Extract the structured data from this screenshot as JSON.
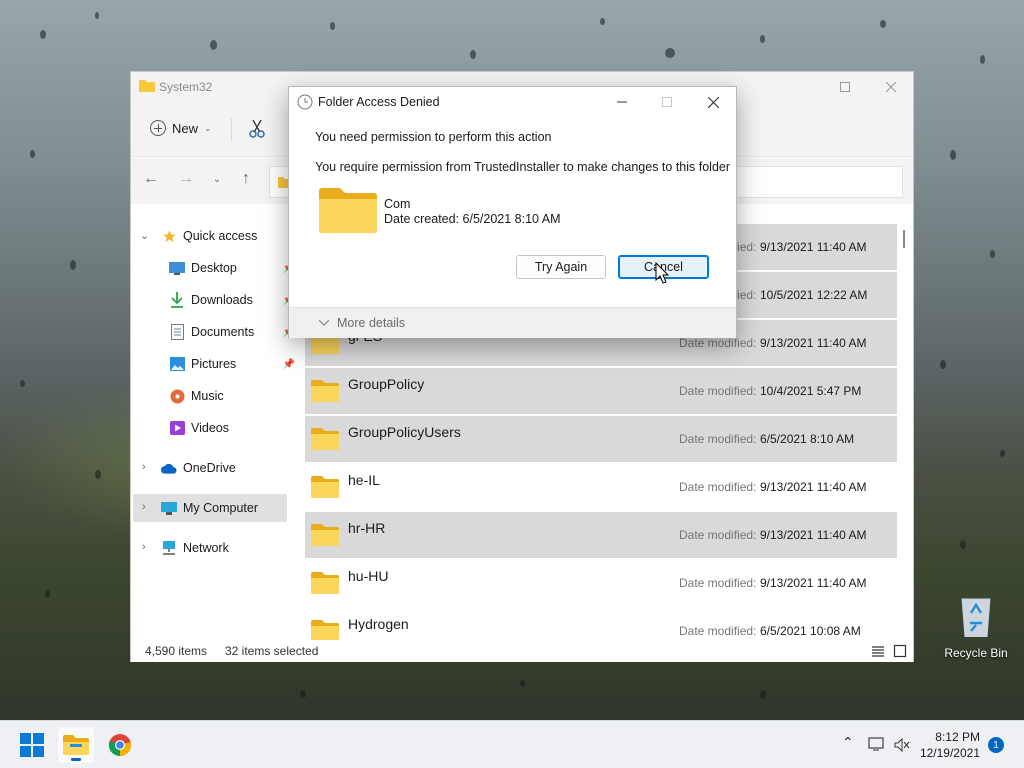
{
  "explorer": {
    "title": "System32",
    "toolbar": {
      "new_label": "New"
    },
    "sidebar": {
      "quick_access": "Quick access",
      "items": [
        {
          "label": "Desktop",
          "icon": "desktop-icon"
        },
        {
          "label": "Downloads",
          "icon": "downloads-icon"
        },
        {
          "label": "Documents",
          "icon": "documents-icon"
        },
        {
          "label": "Pictures",
          "icon": "pictures-icon"
        },
        {
          "label": "Music",
          "icon": "music-icon"
        },
        {
          "label": "Videos",
          "icon": "videos-icon"
        }
      ],
      "onedrive": "OneDrive",
      "my_computer": "My Computer",
      "network": "Network"
    },
    "files": {
      "date_label": "Date modified:",
      "rows": [
        {
          "name": "",
          "date": "9/13/2021 11:40 AM",
          "selected": false
        },
        {
          "name": "",
          "date": "9/13/2021 11:40 AM",
          "selected": true
        },
        {
          "name": "",
          "date": "10/5/2021 12:22 AM",
          "selected": true
        },
        {
          "name": "gl-ES",
          "date": "9/13/2021 11:40 AM",
          "selected": true
        },
        {
          "name": "GroupPolicy",
          "date": "10/4/2021 5:47 PM",
          "selected": true
        },
        {
          "name": "GroupPolicyUsers",
          "date": "6/5/2021 8:10 AM",
          "selected": true
        },
        {
          "name": "he-IL",
          "date": "9/13/2021 11:40 AM",
          "selected": false
        },
        {
          "name": "hr-HR",
          "date": "9/13/2021 11:40 AM",
          "selected": true
        },
        {
          "name": "hu-HU",
          "date": "9/13/2021 11:40 AM",
          "selected": false
        },
        {
          "name": "Hydrogen",
          "date": "6/5/2021 10:08 AM",
          "selected": false
        }
      ]
    },
    "status": {
      "item_count": "4,590 items",
      "selected_count": "32 items selected"
    }
  },
  "dialog": {
    "title": "Folder Access Denied",
    "message1": "You need permission to perform this action",
    "message2": "You require permission from TrustedInstaller to make changes to this folder",
    "folder_name": "Com",
    "folder_date": "Date created: 6/5/2021 8:10 AM",
    "try_again": "Try Again",
    "cancel": "Cancel",
    "more_details": "More details"
  },
  "desktop": {
    "recycle_bin": "Recycle Bin"
  },
  "taskbar": {
    "time": "8:12 PM",
    "date": "12/19/2021",
    "notification_count": "1"
  },
  "colors": {
    "accent": "#0078d4",
    "folder": "#f8c83a",
    "selection": "#d9d9d9"
  }
}
